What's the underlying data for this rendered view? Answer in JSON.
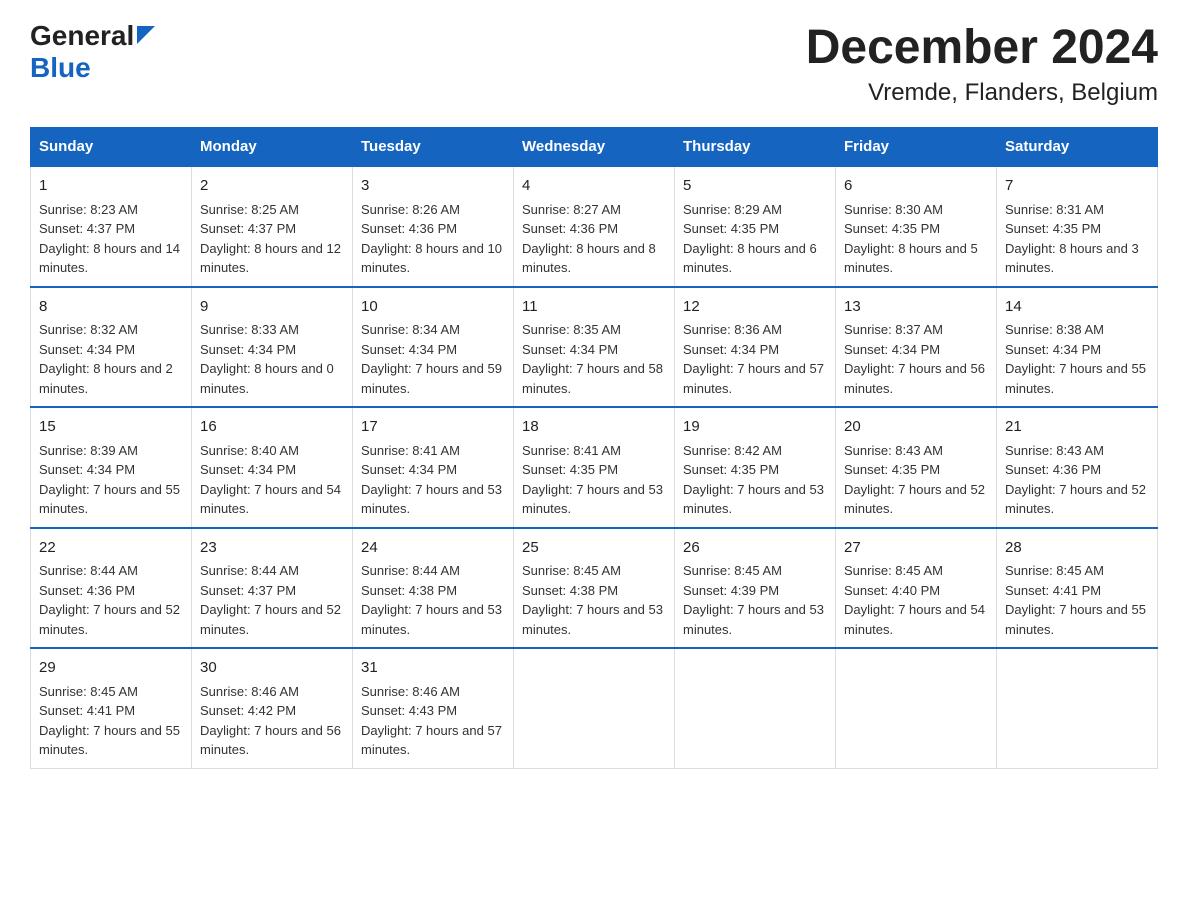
{
  "header": {
    "logo_line1": "General",
    "logo_line2": "Blue",
    "title": "December 2024",
    "subtitle": "Vremde, Flanders, Belgium"
  },
  "days_of_week": [
    "Sunday",
    "Monday",
    "Tuesday",
    "Wednesday",
    "Thursday",
    "Friday",
    "Saturday"
  ],
  "weeks": [
    [
      {
        "day": "1",
        "sunrise": "8:23 AM",
        "sunset": "4:37 PM",
        "daylight": "8 hours and 14 minutes."
      },
      {
        "day": "2",
        "sunrise": "8:25 AM",
        "sunset": "4:37 PM",
        "daylight": "8 hours and 12 minutes."
      },
      {
        "day": "3",
        "sunrise": "8:26 AM",
        "sunset": "4:36 PM",
        "daylight": "8 hours and 10 minutes."
      },
      {
        "day": "4",
        "sunrise": "8:27 AM",
        "sunset": "4:36 PM",
        "daylight": "8 hours and 8 minutes."
      },
      {
        "day": "5",
        "sunrise": "8:29 AM",
        "sunset": "4:35 PM",
        "daylight": "8 hours and 6 minutes."
      },
      {
        "day": "6",
        "sunrise": "8:30 AM",
        "sunset": "4:35 PM",
        "daylight": "8 hours and 5 minutes."
      },
      {
        "day": "7",
        "sunrise": "8:31 AM",
        "sunset": "4:35 PM",
        "daylight": "8 hours and 3 minutes."
      }
    ],
    [
      {
        "day": "8",
        "sunrise": "8:32 AM",
        "sunset": "4:34 PM",
        "daylight": "8 hours and 2 minutes."
      },
      {
        "day": "9",
        "sunrise": "8:33 AM",
        "sunset": "4:34 PM",
        "daylight": "8 hours and 0 minutes."
      },
      {
        "day": "10",
        "sunrise": "8:34 AM",
        "sunset": "4:34 PM",
        "daylight": "7 hours and 59 minutes."
      },
      {
        "day": "11",
        "sunrise": "8:35 AM",
        "sunset": "4:34 PM",
        "daylight": "7 hours and 58 minutes."
      },
      {
        "day": "12",
        "sunrise": "8:36 AM",
        "sunset": "4:34 PM",
        "daylight": "7 hours and 57 minutes."
      },
      {
        "day": "13",
        "sunrise": "8:37 AM",
        "sunset": "4:34 PM",
        "daylight": "7 hours and 56 minutes."
      },
      {
        "day": "14",
        "sunrise": "8:38 AM",
        "sunset": "4:34 PM",
        "daylight": "7 hours and 55 minutes."
      }
    ],
    [
      {
        "day": "15",
        "sunrise": "8:39 AM",
        "sunset": "4:34 PM",
        "daylight": "7 hours and 55 minutes."
      },
      {
        "day": "16",
        "sunrise": "8:40 AM",
        "sunset": "4:34 PM",
        "daylight": "7 hours and 54 minutes."
      },
      {
        "day": "17",
        "sunrise": "8:41 AM",
        "sunset": "4:34 PM",
        "daylight": "7 hours and 53 minutes."
      },
      {
        "day": "18",
        "sunrise": "8:41 AM",
        "sunset": "4:35 PM",
        "daylight": "7 hours and 53 minutes."
      },
      {
        "day": "19",
        "sunrise": "8:42 AM",
        "sunset": "4:35 PM",
        "daylight": "7 hours and 53 minutes."
      },
      {
        "day": "20",
        "sunrise": "8:43 AM",
        "sunset": "4:35 PM",
        "daylight": "7 hours and 52 minutes."
      },
      {
        "day": "21",
        "sunrise": "8:43 AM",
        "sunset": "4:36 PM",
        "daylight": "7 hours and 52 minutes."
      }
    ],
    [
      {
        "day": "22",
        "sunrise": "8:44 AM",
        "sunset": "4:36 PM",
        "daylight": "7 hours and 52 minutes."
      },
      {
        "day": "23",
        "sunrise": "8:44 AM",
        "sunset": "4:37 PM",
        "daylight": "7 hours and 52 minutes."
      },
      {
        "day": "24",
        "sunrise": "8:44 AM",
        "sunset": "4:38 PM",
        "daylight": "7 hours and 53 minutes."
      },
      {
        "day": "25",
        "sunrise": "8:45 AM",
        "sunset": "4:38 PM",
        "daylight": "7 hours and 53 minutes."
      },
      {
        "day": "26",
        "sunrise": "8:45 AM",
        "sunset": "4:39 PM",
        "daylight": "7 hours and 53 minutes."
      },
      {
        "day": "27",
        "sunrise": "8:45 AM",
        "sunset": "4:40 PM",
        "daylight": "7 hours and 54 minutes."
      },
      {
        "day": "28",
        "sunrise": "8:45 AM",
        "sunset": "4:41 PM",
        "daylight": "7 hours and 55 minutes."
      }
    ],
    [
      {
        "day": "29",
        "sunrise": "8:45 AM",
        "sunset": "4:41 PM",
        "daylight": "7 hours and 55 minutes."
      },
      {
        "day": "30",
        "sunrise": "8:46 AM",
        "sunset": "4:42 PM",
        "daylight": "7 hours and 56 minutes."
      },
      {
        "day": "31",
        "sunrise": "8:46 AM",
        "sunset": "4:43 PM",
        "daylight": "7 hours and 57 minutes."
      },
      null,
      null,
      null,
      null
    ]
  ],
  "labels": {
    "sunrise": "Sunrise:",
    "sunset": "Sunset:",
    "daylight": "Daylight:"
  }
}
